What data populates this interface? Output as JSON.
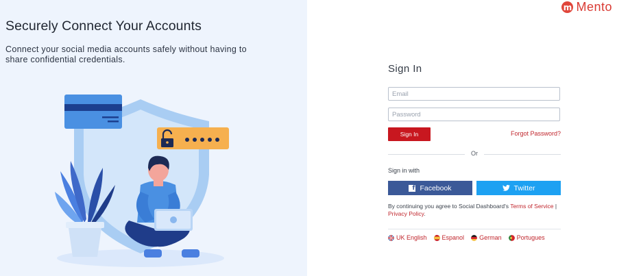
{
  "left": {
    "headline": "Securely Connect Your Accounts",
    "subtext": "Connect your social media accounts safely without having to share confidential credentials."
  },
  "brand": {
    "logo_letter": "m",
    "name": "Mento",
    "color": "#d93a33"
  },
  "signin": {
    "title": "Sign In",
    "email_placeholder": "Email",
    "password_placeholder": "Password",
    "submit_label": "Sign In",
    "forgot_label": "Forgot Password?",
    "or_label": "Or",
    "signin_with_label": "Sign in with",
    "facebook_label": "Facebook",
    "twitter_label": "Twitter",
    "agree_prefix": "By continuing you agree to Social Dashboard's ",
    "terms_label": "Terms of Service",
    "separator": " | ",
    "privacy_label": "Privacy Policy",
    "agree_suffix": "."
  },
  "languages": [
    {
      "label": "UK English",
      "flag": "uk-flag-icon"
    },
    {
      "label": "Espanol",
      "flag": "spain-flag-icon"
    },
    {
      "label": "German",
      "flag": "germany-flag-icon"
    },
    {
      "label": "Portugues",
      "flag": "portugal-flag-icon"
    }
  ],
  "colors": {
    "accent_red": "#c8171f",
    "facebook": "#3b5998",
    "twitter": "#1da1f2",
    "left_bg": "#eef4fd"
  }
}
